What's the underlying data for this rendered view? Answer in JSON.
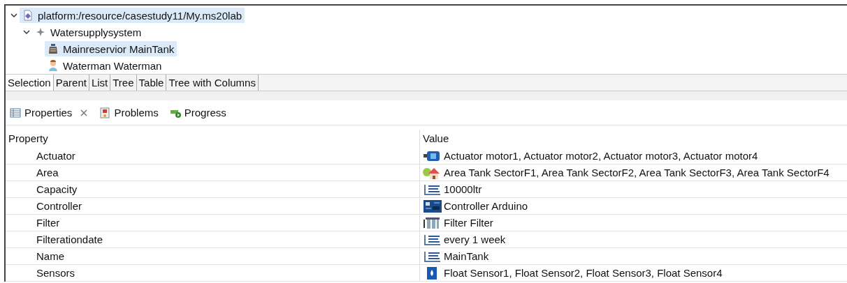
{
  "tree": [
    {
      "label": "platform:/resource/casestudy11/My.ms20lab",
      "kind": "resource",
      "expanded": true,
      "selected": true,
      "children": [
        {
          "label": "Watersupplysystem",
          "kind": "system",
          "expanded": true,
          "selected": false,
          "children": [
            {
              "label": "Mainreservior MainTank",
              "kind": "tank",
              "selected": true
            },
            {
              "label": "Waterman Waterman",
              "kind": "person",
              "selected": false
            }
          ]
        }
      ]
    }
  ],
  "tabs": [
    {
      "label": "Selection",
      "selected": true
    },
    {
      "label": "Parent",
      "selected": false
    },
    {
      "label": "List",
      "selected": false
    },
    {
      "label": "Tree",
      "selected": false
    },
    {
      "label": "Table",
      "selected": false
    },
    {
      "label": "Tree with Columns",
      "selected": false
    }
  ],
  "views": [
    {
      "label": "Properties",
      "kind": "properties",
      "closable": true
    },
    {
      "label": "Problems",
      "kind": "problems",
      "closable": false
    },
    {
      "label": "Progress",
      "kind": "progress",
      "closable": false
    }
  ],
  "table": {
    "columns": [
      "Property",
      "Value"
    ],
    "rows": [
      {
        "property": "Actuator",
        "kind": "motor",
        "value": "Actuator motor1, Actuator motor2, Actuator motor3, Actuator motor4"
      },
      {
        "property": "Area",
        "kind": "area",
        "value": "Area Tank SectorF1, Area Tank SectorF2, Area Tank SectorF3, Area Tank SectorF4"
      },
      {
        "property": "Capacity",
        "kind": "text",
        "value": "10000ltr"
      },
      {
        "property": "Controller",
        "kind": "board",
        "value": "Controller Arduino"
      },
      {
        "property": "Filter",
        "kind": "filter",
        "value": "Filter Filter"
      },
      {
        "property": "Filterationdate",
        "kind": "text",
        "value": "every 1 week"
      },
      {
        "property": "Name",
        "kind": "text",
        "value": "MainTank"
      },
      {
        "property": "Sensors",
        "kind": "sensor",
        "value": "Float Sensor1, Float Sensor2, Float Sensor3, Float Sensor4"
      }
    ]
  }
}
